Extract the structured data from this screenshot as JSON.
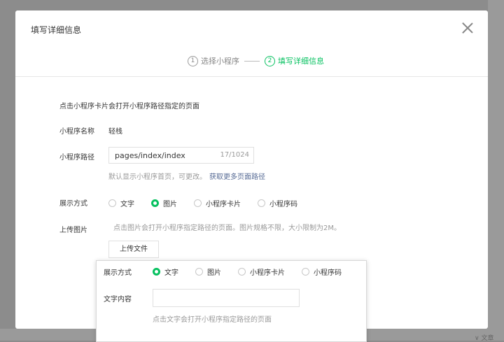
{
  "dialog": {
    "title": "填写详细信息",
    "steps": [
      {
        "num": "1",
        "label": "选择小程序"
      },
      {
        "num": "2",
        "label": "填写详细信息"
      }
    ],
    "hint_top": "点击小程序卡片会打开小程序路径指定的页面",
    "name_label": "小程序名称",
    "name_value": "轻栈",
    "path_label": "小程序路径",
    "path_value": "pages/index/index",
    "path_count": "17/1024",
    "path_hint": "默认显示小程序首页，可更改。",
    "path_link": "获取更多页面路径",
    "display_label": "展示方式",
    "display_options": [
      "文字",
      "图片",
      "小程序卡片",
      "小程序码"
    ],
    "display_selected": "图片",
    "upload_label": "上传图片",
    "upload_hint": "点击图片会打开小程序指定路径的页面。图片规格不限，大小限制为2M。",
    "upload_button": "上传文件"
  },
  "popup": {
    "display_label": "展示方式",
    "display_options": [
      "文字",
      "图片",
      "小程序卡片",
      "小程序码"
    ],
    "display_selected": "文字",
    "text_label": "文字内容",
    "text_value": "",
    "text_hint": "点击文字会打开小程序指定路径的页面"
  },
  "colors": {
    "accent": "#07c160",
    "link": "#576b95",
    "overlay": "#8c8c8c"
  }
}
